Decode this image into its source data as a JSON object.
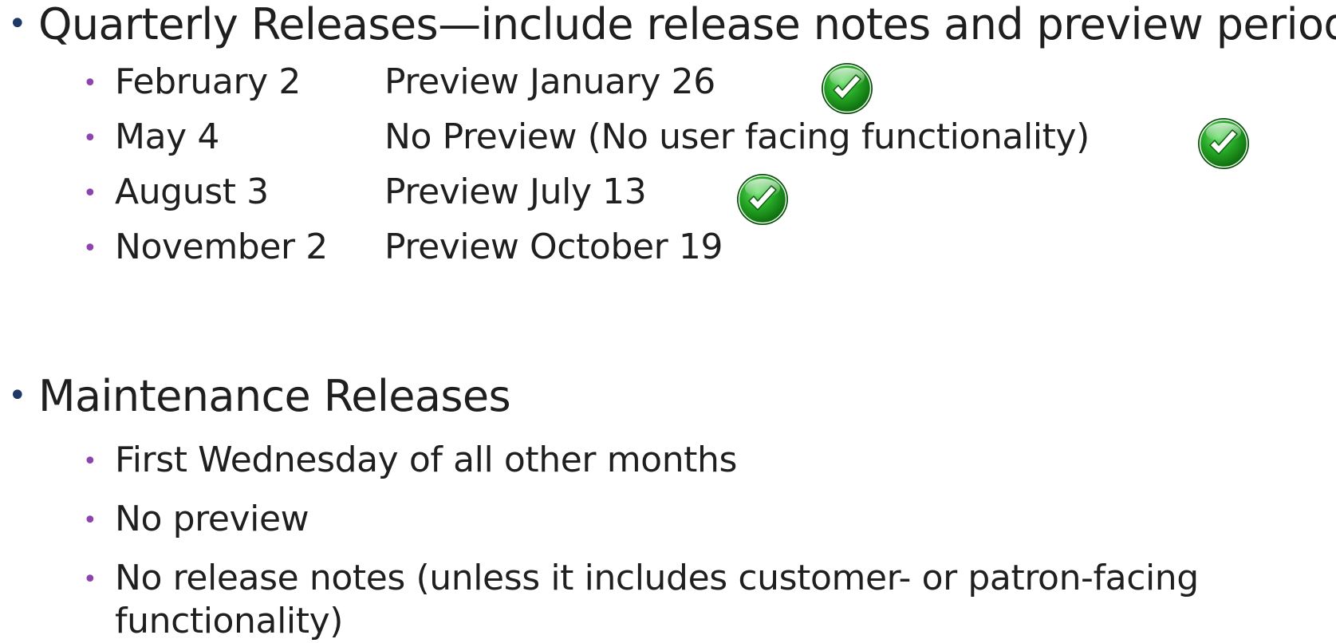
{
  "quarterly": {
    "heading": "Quarterly Releases—include release notes and preview period",
    "items": [
      {
        "date": "February 2",
        "note": "Preview January 26",
        "checked": true
      },
      {
        "date": "May 4",
        "note": "No Preview (No user facing functionality)",
        "checked": true
      },
      {
        "date": "August 3",
        "note": "Preview July 13",
        "checked": true
      },
      {
        "date": "November 2",
        "note": "Preview October 19",
        "checked": false
      }
    ]
  },
  "maintenance": {
    "heading": "Maintenance Releases",
    "items": [
      "First Wednesday of all other months",
      "No preview",
      "No release notes (unless it includes customer- or patron-facing functionality)"
    ]
  },
  "icons": {
    "bullet_primary": "bullet-dot",
    "bullet_secondary": "bullet-dot",
    "check": "green-checkmark-icon"
  },
  "colors": {
    "primary_bullet": "#1f3864",
    "secondary_bullet": "#8e44ad",
    "check_green": "#1e9a1e"
  }
}
